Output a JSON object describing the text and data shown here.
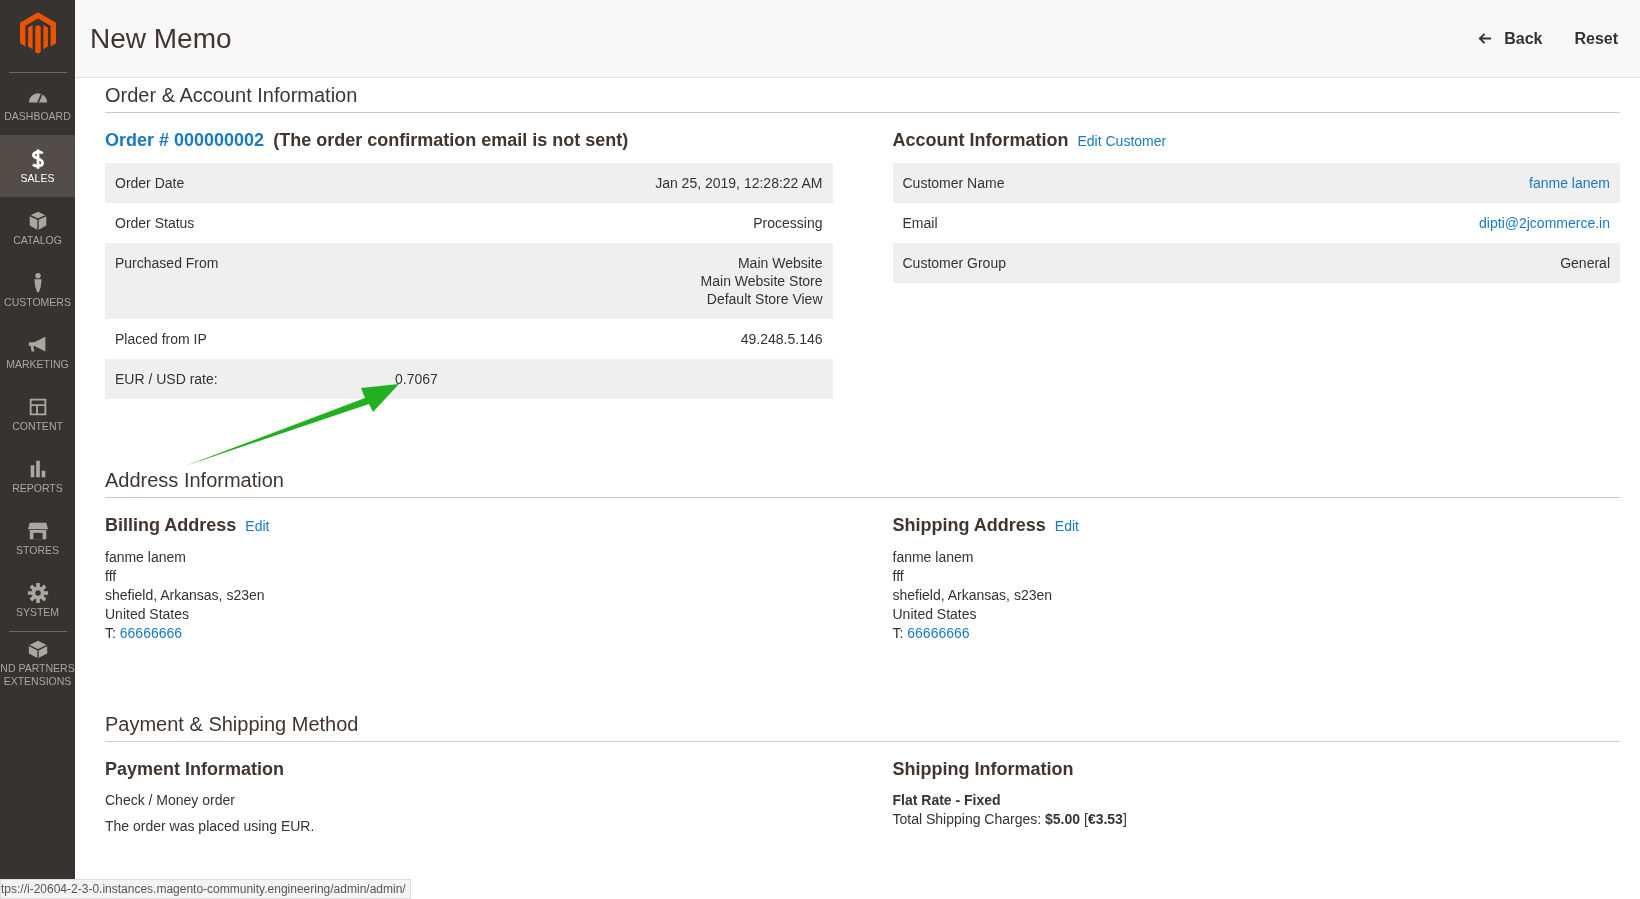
{
  "sidebar": {
    "items": [
      {
        "lines": [
          "DASHBOARD"
        ],
        "selected": false
      },
      {
        "lines": [
          "SALES"
        ],
        "selected": true
      },
      {
        "lines": [
          "CATALOG"
        ],
        "selected": false
      },
      {
        "lines": [
          "CUSTOMERS"
        ],
        "selected": false
      },
      {
        "lines": [
          "MARKETING"
        ],
        "selected": false
      },
      {
        "lines": [
          "CONTENT"
        ],
        "selected": false
      },
      {
        "lines": [
          "REPORTS"
        ],
        "selected": false
      },
      {
        "lines": [
          "STORES"
        ],
        "selected": false
      },
      {
        "lines": [
          "SYSTEM"
        ],
        "selected": false
      },
      {
        "lines": [
          "ND PARTNERS",
          "EXTENSIONS"
        ],
        "selected": false
      }
    ]
  },
  "header": {
    "title": "New Memo",
    "back": "Back",
    "reset": "Reset"
  },
  "order_section": {
    "title": "Order & Account Information",
    "order": {
      "link": "Order # 000000002",
      "note": "(The order confirmation email is not sent)",
      "rows": [
        {
          "label": "Order Date",
          "value": [
            "Jan 25, 2019, 12:28:22 AM"
          ]
        },
        {
          "label": "Order Status",
          "value": [
            "Processing"
          ]
        },
        {
          "label": "Purchased From",
          "value": [
            "Main Website",
            "Main Website Store",
            "Default Store View"
          ]
        },
        {
          "label": "Placed from IP",
          "value": [
            "49.248.5.146"
          ]
        },
        {
          "label": "EUR / USD rate:",
          "value": [
            "0.7067"
          ],
          "kind": "inline"
        }
      ]
    },
    "account": {
      "title": "Account Information",
      "edit": "Edit Customer",
      "rows": [
        {
          "label": "Customer Name",
          "value": "fanme lanem",
          "kind": "link"
        },
        {
          "label": "Email",
          "value": "dipti@2jcommerce.in",
          "kind": "link"
        },
        {
          "label": "Customer Group",
          "value": "General",
          "kind": "text"
        }
      ]
    }
  },
  "address_section": {
    "title": "Address Information",
    "addresses": [
      {
        "title": "Billing Address",
        "edit": "Edit",
        "lines": [
          "fanme lanem",
          "fff",
          "shefield, Arkansas, s23en",
          "United States"
        ],
        "phone_label": "T:",
        "phone": "66666666"
      },
      {
        "title": "Shipping Address",
        "edit": "Edit",
        "lines": [
          "fanme lanem",
          "fff",
          "shefield, Arkansas, s23en",
          "United States"
        ],
        "phone_label": "T:",
        "phone": "66666666"
      }
    ]
  },
  "payment_section": {
    "title": "Payment & Shipping Method",
    "payment": {
      "title": "Payment Information",
      "method": "Check / Money order",
      "note": "The order was placed using EUR."
    },
    "shipping": {
      "title": "Shipping Information",
      "method": "Flat Rate - Fixed",
      "charges": "Total Shipping Charges: **$5.00** [**€3.53**]"
    }
  },
  "status_bar": {
    "url": "tps://i-20604-2-3-0.instances.magento-community.engineering/admin/admin/"
  }
}
